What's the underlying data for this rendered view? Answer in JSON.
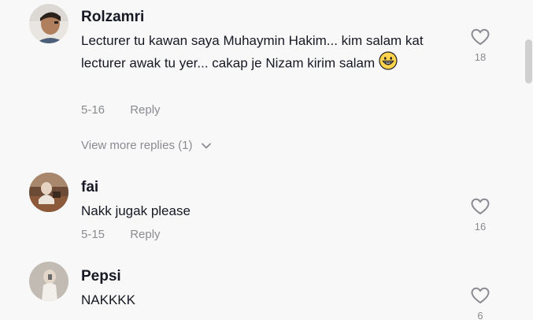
{
  "comments": [
    {
      "username": "Rolzamri",
      "text": "Lecturer tu kawan saya Muhaymin Hakim... kim salam kat lecturer awak tu yer... cakap je Nizam kirim salam",
      "date": "5-16",
      "reply_label": "Reply",
      "likes": "18",
      "emoji": "grinning-face-icon"
    },
    {
      "username": "fai",
      "text": "Nakk jugak please",
      "date": "5-15",
      "reply_label": "Reply",
      "likes": "16"
    },
    {
      "username": "Pepsi",
      "text": "NAKKKK",
      "likes": "6"
    }
  ],
  "view_more_replies": "View more replies (1)",
  "colors": {
    "background": "#f8f8f8",
    "text": "#161823",
    "muted": "#8a8b91"
  }
}
